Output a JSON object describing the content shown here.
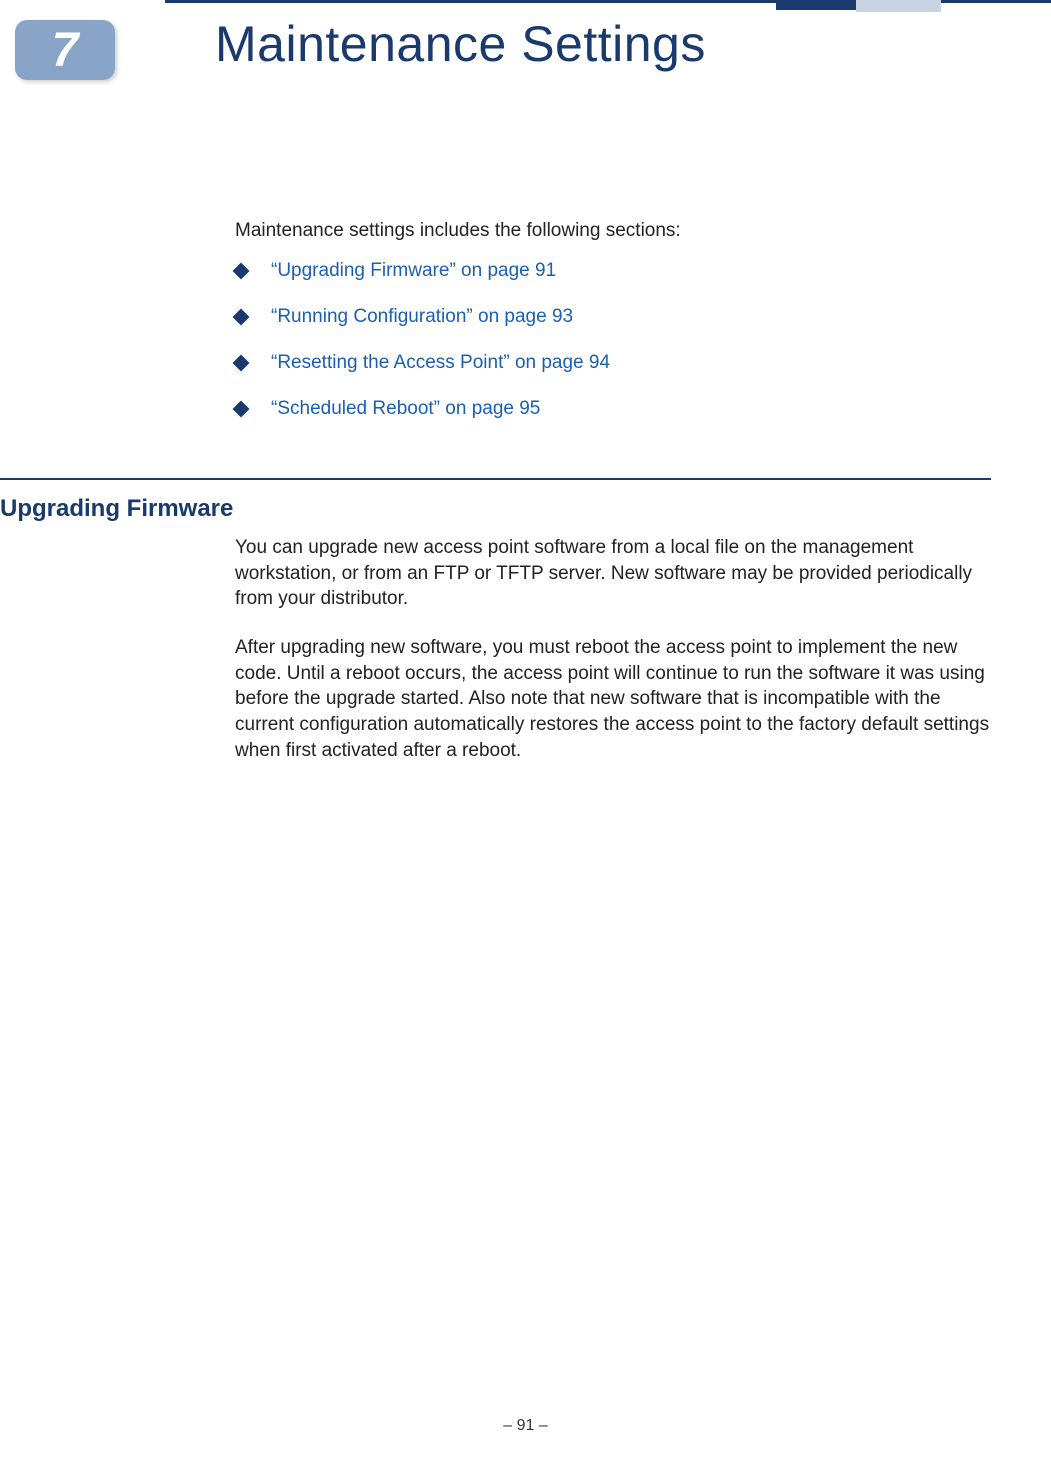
{
  "chapter": {
    "number": "7",
    "title": "Maintenance Settings"
  },
  "intro": "Maintenance settings includes the following sections:",
  "toc": [
    "“Upgrading Firmware” on page 91",
    "“Running Configuration” on page 93",
    "“Resetting the Access Point” on page 94",
    "“Scheduled Reboot” on page 95"
  ],
  "section": {
    "heading": "Upgrading Firmware",
    "para1": "You can upgrade new access point software from a local file on the management workstation, or from an FTP or TFTP server. New software may be provided periodically from your distributor.",
    "para2": "After upgrading new software, you must reboot the access point to implement the new code. Until a reboot occurs, the access point will continue to run the software it was using before the upgrade started. Also note that new software that is incompatible with the current configuration automatically restores the access point to the factory default settings when first activated after a reboot."
  },
  "footer": "–  91  –"
}
